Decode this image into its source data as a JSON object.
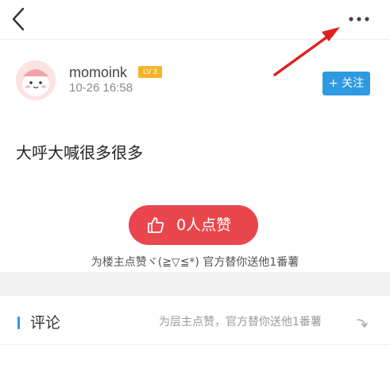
{
  "header": {
    "back_icon": "chevron-left-icon",
    "more_icon": "more-horizontal-icon"
  },
  "author": {
    "name": "momoink",
    "level": "LV 3",
    "time": "10-26 16:58",
    "follow_label": "+ 关注"
  },
  "post": {
    "content": "大呼大喊很多很多"
  },
  "like": {
    "label": "0人点赞",
    "icon": "thumbs-up-icon",
    "hint": "为楼主点赞ヾ(≧▽≦*) 官方替你送他1番薯"
  },
  "comments": {
    "title": "评论",
    "hint": "为层主点赞，官方替你送他1番薯",
    "hint_icon": "curved-arrow-icon"
  },
  "colors": {
    "accent_blue": "#2f9ae0",
    "like_red": "#e9464e",
    "level_gold": "#f5b427",
    "annotation_arrow": "#e02020"
  }
}
